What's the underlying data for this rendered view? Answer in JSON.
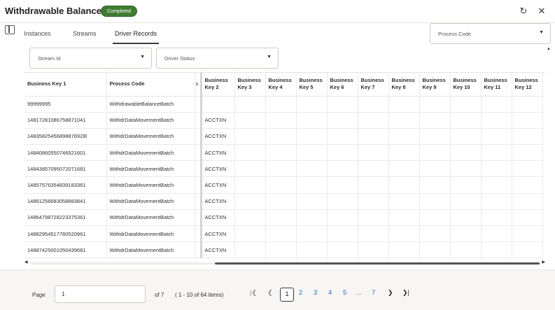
{
  "header": {
    "title": "Withdrawable Balance",
    "badge": "Completed",
    "refresh_icon": "refresh-icon",
    "close_icon": "close-icon"
  },
  "tabs": [
    {
      "label": "Instances",
      "active": false
    },
    {
      "label": "Streams",
      "active": false
    },
    {
      "label": "Driver Records",
      "active": true
    }
  ],
  "filters": {
    "process_code": "Process Code",
    "stream_id": "Stream Id",
    "driver_status": "Driver Status"
  },
  "table": {
    "columns": [
      "Business Key 1",
      "Process Code",
      "Business Key 2",
      "Business Key 3",
      "Business Key 4",
      "Business Key 5",
      "Business Key 6",
      "Business Key 7",
      "Business Key 8",
      "Business Key 9",
      "Business Key 10",
      "Business Key 11",
      "Business Key 12"
    ],
    "truncated_marker": "s",
    "rows": [
      [
        "99999995",
        "WithdrawableBalanceBatch",
        ""
      ],
      [
        "14817281086758871041",
        "WithdrDataMovementBatch",
        "ACCTXN"
      ],
      [
        "14835825456898876928l",
        "WithdrDataMovementBatch",
        "ACCTXN"
      ],
      [
        "14840860550746521601",
        "WithdrDataMovementBatch",
        "ACCTXN"
      ],
      [
        "14843857095072071681",
        "WithdrDataMovementBatch",
        "ACCTXN"
      ],
      [
        "14857576354839183361",
        "WithdrDataMovementBatch",
        "ACCTXN"
      ],
      [
        "14861256683058883841",
        "WithdrDataMovementBatch",
        "ACCTXN"
      ],
      [
        "14864798728223375361",
        "WithdrDataMovementBatch",
        "ACCTXN"
      ],
      [
        "14882954517780520961",
        "WithdrDataMovementBatch",
        "ACCTXN"
      ],
      [
        "14887425001050439681",
        "WithdrDataMovementBatch",
        "ACCTXN"
      ]
    ]
  },
  "pagination": {
    "page_label": "Page",
    "page_value": "1",
    "of_label": "of 7",
    "range_label": "( 1 - 10 of 64 items)",
    "pages": [
      "1",
      "2",
      "3",
      "4",
      "5",
      "...",
      "7"
    ]
  }
}
